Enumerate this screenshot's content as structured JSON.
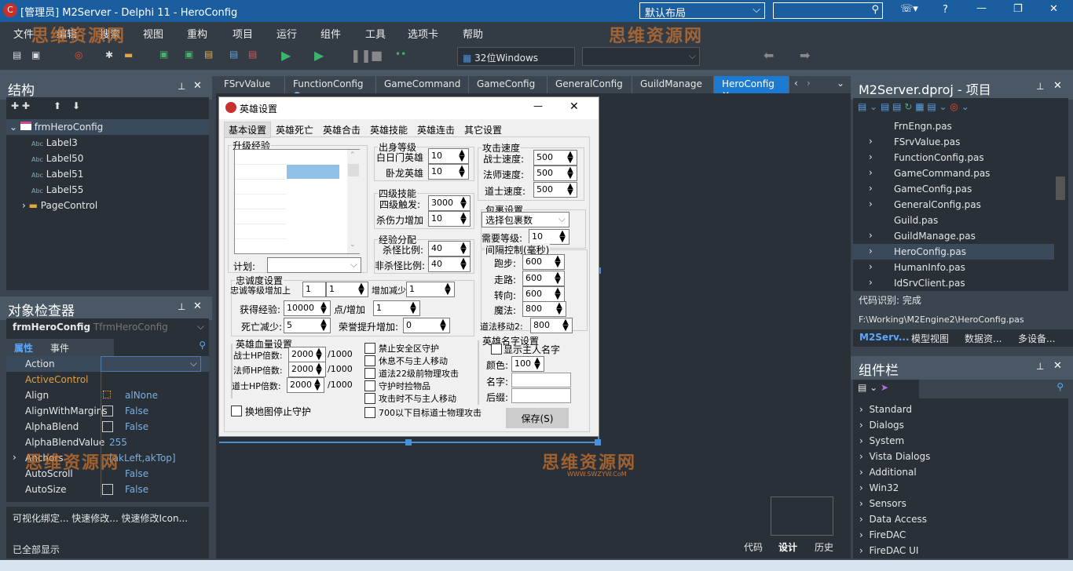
{
  "window": {
    "title": "[管理员] M2Server - Delphi 11 - HeroConfig",
    "layout": "默认布局",
    "search_placeholder": "",
    "help": "?"
  },
  "menu": [
    "文件",
    "编辑",
    "搜索",
    "视图",
    "重构",
    "项目",
    "运行",
    "组件",
    "工具",
    "选项卡",
    "帮助"
  ],
  "toolbar": {
    "platform": "32位Windows",
    "config": ""
  },
  "structure": {
    "title": "结构",
    "root": "frmHeroConfig",
    "items": [
      "Label3",
      "Label50",
      "Label51",
      "Label55",
      "PageControl"
    ]
  },
  "inspector": {
    "title": "对象检查器",
    "object": "frmHeroConfig",
    "type": "TfrmHeroConfig",
    "tabs": [
      "属性",
      "事件"
    ],
    "rows": [
      {
        "name": "Action",
        "value": ""
      },
      {
        "name": "ActiveControl",
        "value": ""
      },
      {
        "name": "Align",
        "value": "alNone"
      },
      {
        "name": "AlignWithMargins",
        "value": "False"
      },
      {
        "name": "AlphaBlend",
        "value": "False"
      },
      {
        "name": "AlphaBlendValue",
        "value": "255"
      },
      {
        "name": "Anchors",
        "value": "[akLeft,akTop]"
      },
      {
        "name": "AutoScroll",
        "value": "False"
      },
      {
        "name": "AutoSize",
        "value": "False"
      }
    ],
    "actions": "可视化绑定... 快速修改... 快速修改Icon...",
    "status": "已全部显示"
  },
  "editor_tabs": [
    "FSrvValue",
    "FunctionConfig",
    "GameCommand",
    "GameConfig",
    "GeneralConfig",
    "GuildManage",
    "HeroConfig"
  ],
  "active_tab": "HeroConfig",
  "form": {
    "title": "英雄设置",
    "tabs": [
      "基本设置",
      "英雄死亡",
      "英雄合击",
      "英雄技能",
      "英雄连击",
      "其它设置"
    ],
    "upgrade": {
      "caption": "升级经验",
      "plan_label": "计划:",
      "plan_value": ""
    },
    "birth": {
      "caption": "出身等级",
      "rows": [
        {
          "label": "白日门英雄",
          "value": "10"
        },
        {
          "label": "卧龙英雄",
          "value": "10"
        }
      ]
    },
    "skill4": {
      "caption": "四级技能",
      "rows": [
        {
          "label": "四级触发:",
          "value": "3000"
        },
        {
          "label": "杀伤力增加",
          "value": "10"
        }
      ]
    },
    "exp": {
      "caption": "经验分配",
      "rows": [
        {
          "label": "杀怪比例:",
          "value": "40"
        },
        {
          "label": "非杀怪比例:",
          "value": "40"
        }
      ]
    },
    "speed": {
      "caption": "攻击速度",
      "rows": [
        {
          "label": "战士速度:",
          "value": "500"
        },
        {
          "label": "法师速度:",
          "value": "500"
        },
        {
          "label": "道士速度:",
          "value": "500"
        }
      ]
    },
    "bag": {
      "caption": "包裹设置",
      "select": "选择包裹数",
      "level_label": "需要等级:",
      "level": "10"
    },
    "interval": {
      "caption": "间隔控制(毫秒)",
      "rows": [
        {
          "label": "跑步:",
          "value": "600"
        },
        {
          "label": "走路:",
          "value": "600"
        },
        {
          "label": "转向:",
          "value": "600"
        },
        {
          "label": "魔法:",
          "value": "800"
        },
        {
          "label": "道法移动2:",
          "value": "800"
        }
      ]
    },
    "loyalty": {
      "caption": "忠诚度设置",
      "overlap_label": "忠诚等级增加上",
      "v1": "1",
      "v2": "1",
      "overlap_label2": "增加减少",
      "v3": "1",
      "exp_label": "获得经验:",
      "exp": "10000",
      "point_label": "点/增加",
      "point": "1",
      "death_label": "死亡减少:",
      "death": "5",
      "honor_label": "荣誉提升增加:",
      "honor": "0"
    },
    "hp": {
      "caption": "英雄血量设置",
      "rows": [
        {
          "label": "战士HP倍数:",
          "value": "2000",
          "unit": "/1000"
        },
        {
          "label": "法师HP倍数:",
          "value": "2000",
          "unit": "/1000"
        },
        {
          "label": "道士HP倍数:",
          "value": "2000",
          "unit": "/1000"
        }
      ]
    },
    "checks": [
      "禁止安全区守护",
      "休息不与主人移动",
      "道法22级前物理攻击",
      "守护时捡物品",
      "攻击时不与主人移动",
      "700以下目标道士物理攻击"
    ],
    "map_check": "换地图停止守护",
    "name": {
      "caption": "英雄名字设置",
      "show": "显示主人名字",
      "color_label": "颜色:",
      "color": "100",
      "name_label": "名字:",
      "suffix_label": "后缀:"
    },
    "save": "保存(S)"
  },
  "bottom_tabs": [
    "代码",
    "设计",
    "历史"
  ],
  "project": {
    "title": "M2Server.dproj - 项目",
    "files": [
      "FrnEngn.pas",
      "FSrvValue.pas",
      "FunctionConfig.pas",
      "GameCommand.pas",
      "GameConfig.pas",
      "GeneralConfig.pas",
      "Guild.pas",
      "GuildManage.pas",
      "HeroConfig.pas",
      "HumanInfo.pas",
      "IdSrvClient.pas"
    ],
    "selected": "HeroConfig.pas",
    "code_status": "代码识别:  完成",
    "path": "F:\\Working\\M2Engine2\\HeroConfig.pas",
    "tabs": [
      "M2Serv...",
      "模型视图",
      "数据资...",
      "多设备..."
    ]
  },
  "palette": {
    "title": "组件栏",
    "items": [
      "Standard",
      "Dialogs",
      "System",
      "Vista Dialogs",
      "Additional",
      "Win32",
      "Sensors",
      "Data Access",
      "FireDAC",
      "FireDAC UI"
    ]
  },
  "watermark": {
    "text": "思维资源网",
    "url": "WWW.SWZYW.CoM"
  }
}
